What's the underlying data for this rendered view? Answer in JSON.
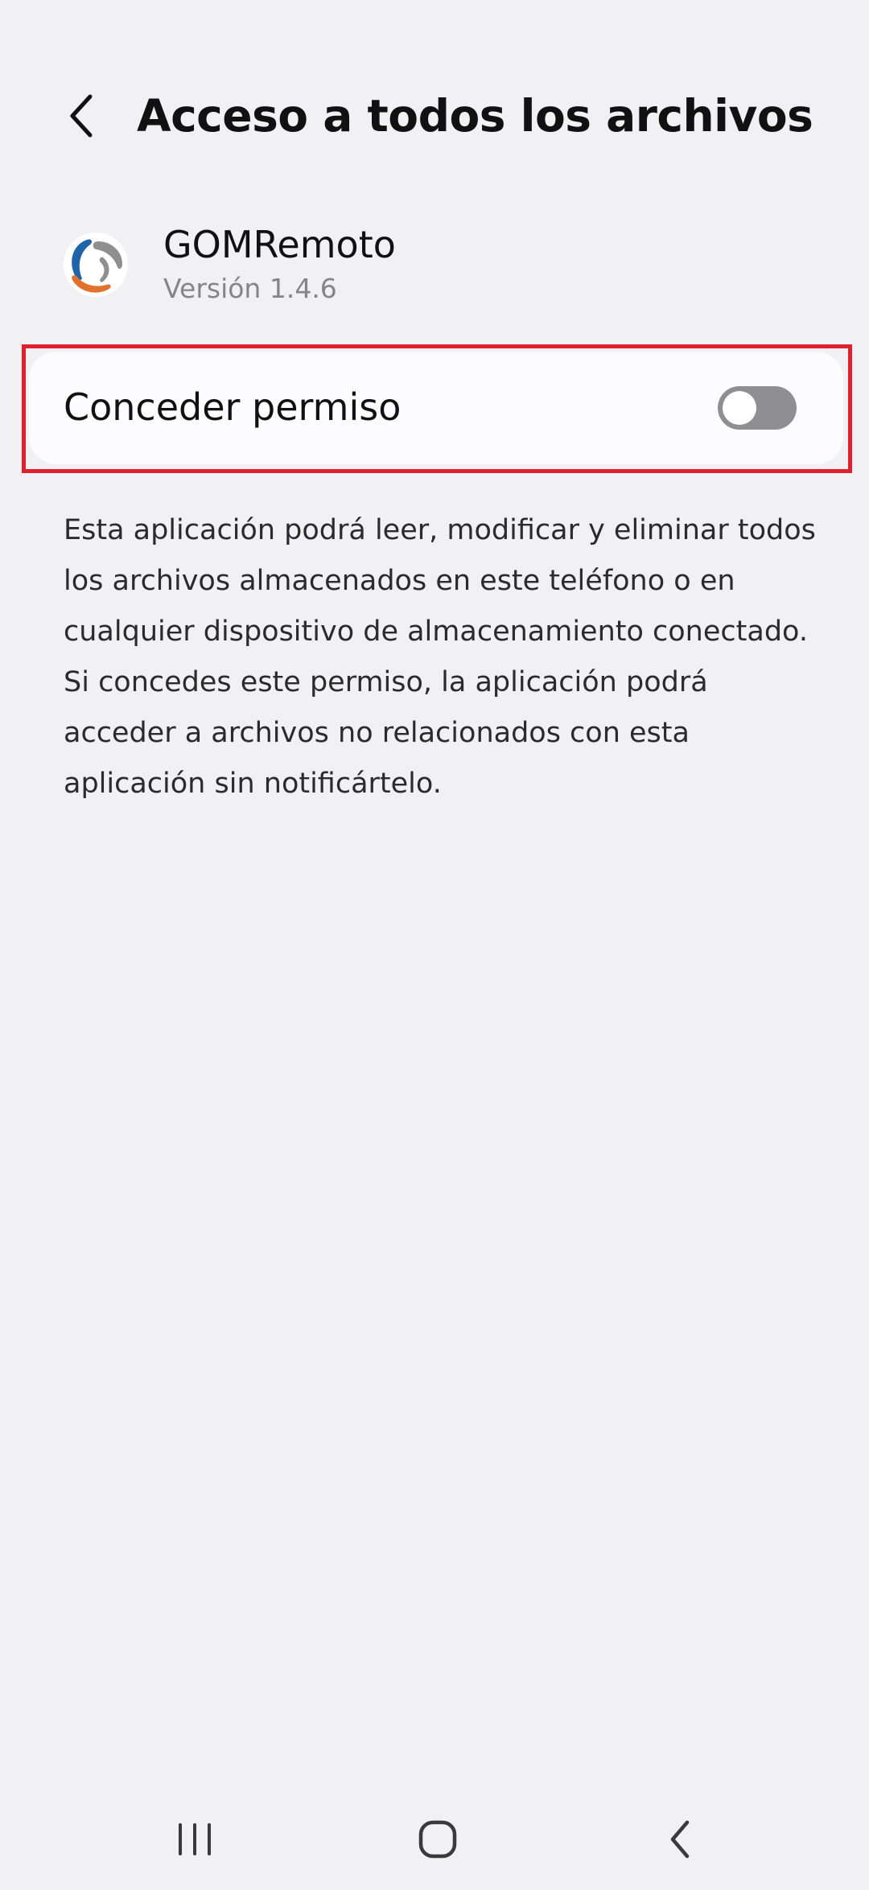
{
  "header": {
    "title": "Acceso a todos los archivos",
    "back_icon": "chevron-left-icon"
  },
  "app": {
    "name": "GOMRemoto",
    "version": "Versión 1.4.6",
    "icon": "gomremote-logo-icon"
  },
  "permission": {
    "label": "Conceder permiso",
    "enabled": false,
    "highlight_color": "#e1202d"
  },
  "description": "Esta aplicación podrá leer, modificar y eliminar todos los archivos almacenados en este teléfono o en cualquier dispositivo de almacenamiento conectado. Si concedes este permiso, la aplicación podrá acceder a archivos no relacionados con esta aplicación sin notificártelo.",
  "navbar": {
    "recents_icon": "recents-icon",
    "home_icon": "home-icon",
    "back_icon": "back-icon"
  },
  "colors": {
    "background": "#f1f1f3",
    "card": "#fcfcfe",
    "toggle_off": "#8e8e93",
    "secondary_text": "#858585"
  }
}
